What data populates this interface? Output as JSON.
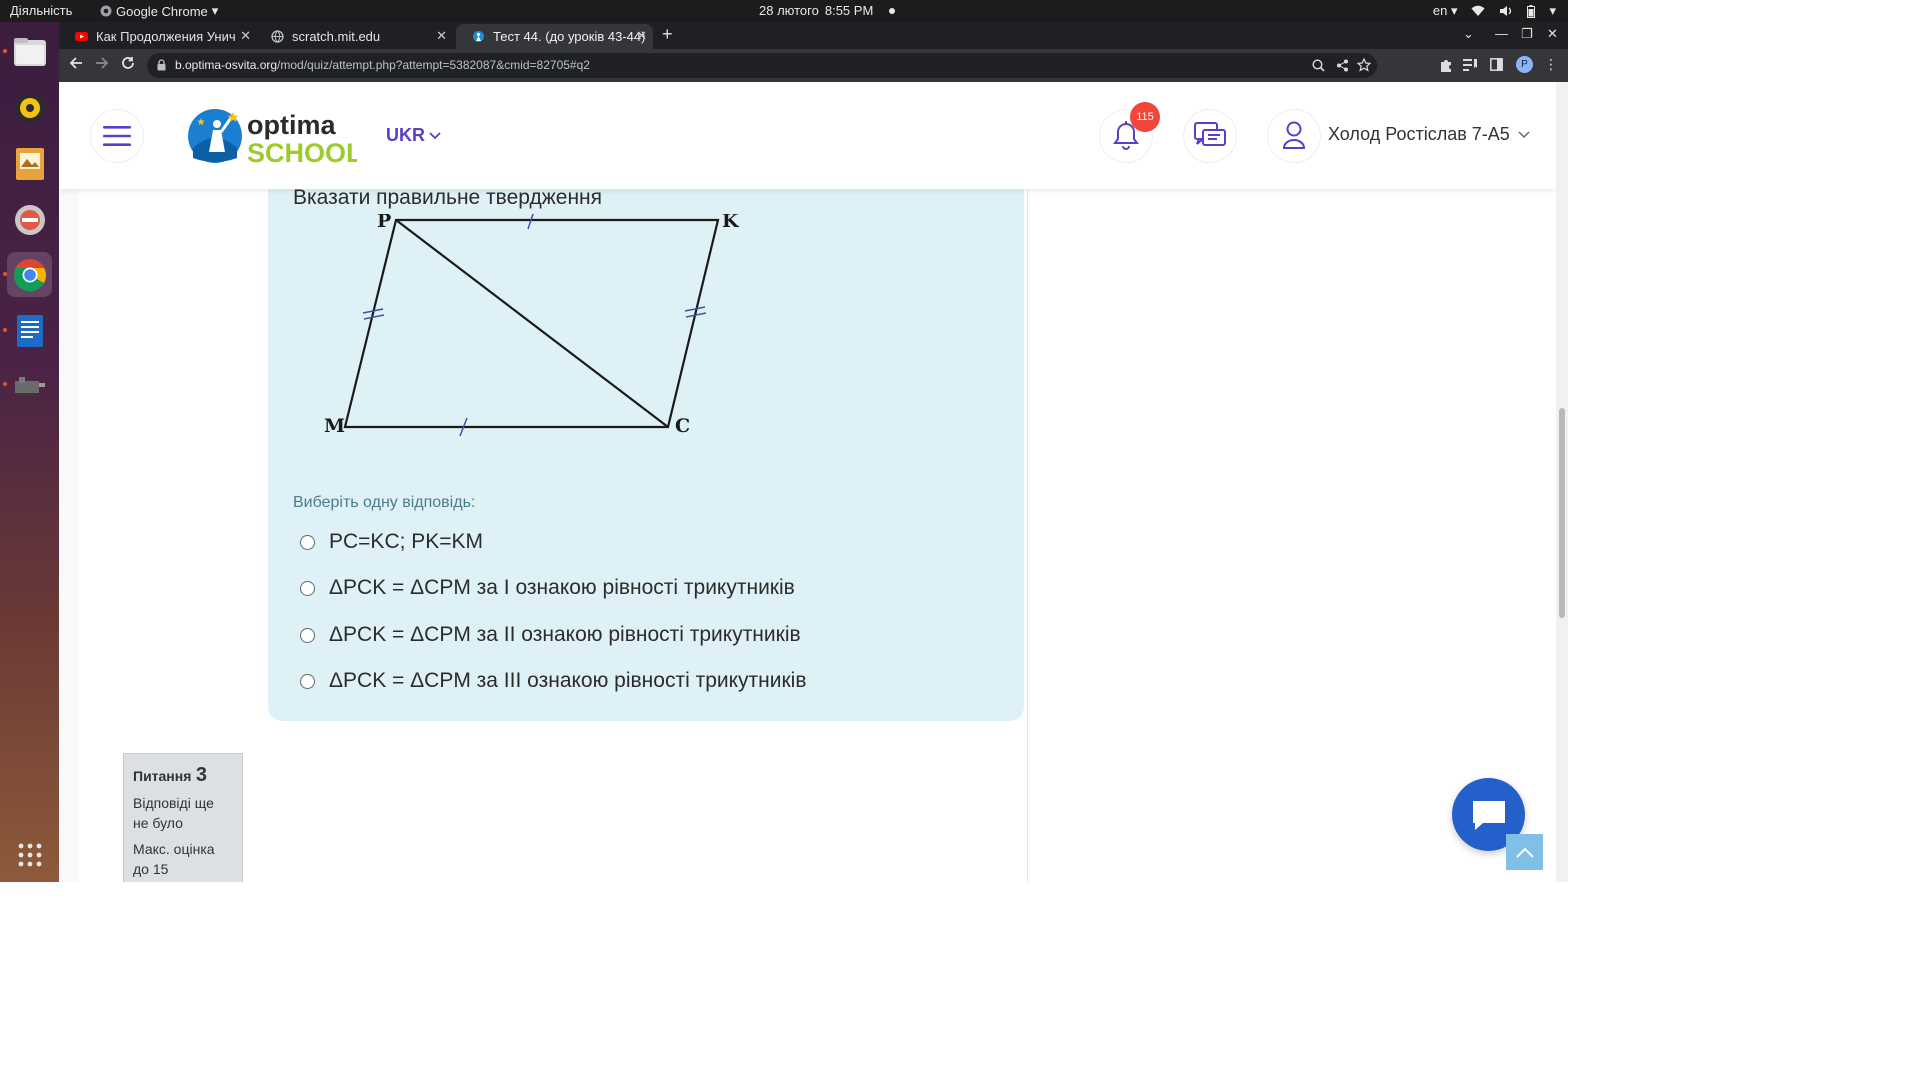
{
  "system_bar": {
    "activities": "Діяльність",
    "app_name": "Google Chrome",
    "date": "28 лютого",
    "time": "8:55 PM",
    "language": "en"
  },
  "browser": {
    "tabs": [
      {
        "title": "Как Продолжения Унич",
        "icon": "youtube-icon"
      },
      {
        "title": "scratch.mit.edu",
        "icon": "globe-icon"
      },
      {
        "title": "Тест 44. (до уроків 43-44)",
        "icon": "optima-icon"
      }
    ],
    "url_domain": "b.optima-osvita.org",
    "url_path": "/mod/quiz/attempt.php?attempt=5382087&cmid=82705#q2",
    "profile_initial": "P"
  },
  "header": {
    "logo_word1": "optima",
    "logo_word2": "SCHOOL",
    "language": "UKR",
    "notification_count": "115",
    "user_name": "Холод Ростіслав 7-А5"
  },
  "question": {
    "text": "Вказати правильне твердження",
    "prompt": "Виберіть одну відповідь:",
    "figure_labels": {
      "p": "P",
      "k": "K",
      "m": "M",
      "c": "C"
    },
    "options": [
      "PC=KC; PK=KM",
      "ΔPCK = ΔCPM за І ознакою рівності трикутників",
      "ΔPCK = ΔCPM за ІІ ознакою рівності трикутників",
      "ΔPCK = ΔCPM за ІІІ ознакою рівності трикутників"
    ]
  },
  "question_nav": {
    "label": "Питання",
    "number": "3",
    "status": "Відповіді ще не було",
    "max_grade": "Макс. оцінка до 15"
  },
  "colors": {
    "question_bg": "#def1f6",
    "accent": "#5a3ec8",
    "chat_button": "#2360c9",
    "badge": "#f2463a"
  }
}
